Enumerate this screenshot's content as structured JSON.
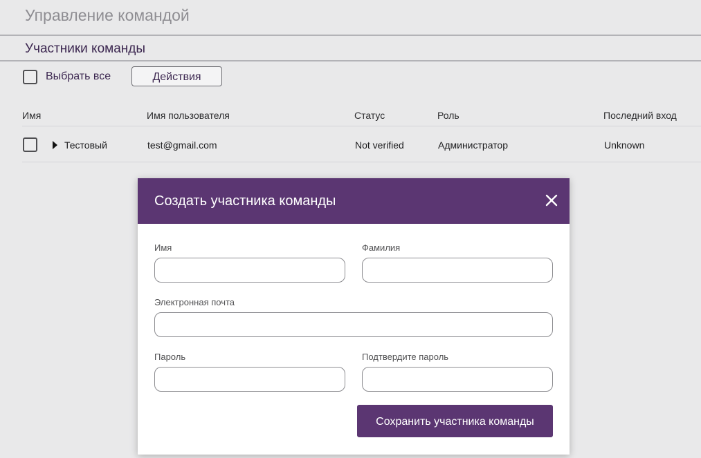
{
  "page": {
    "title": "Управление командой",
    "section_title": "Участники команды"
  },
  "toolbar": {
    "select_all_label": "Выбрать все",
    "actions_label": "Действия"
  },
  "table": {
    "headers": {
      "name": "Имя",
      "username": "Имя пользователя",
      "status": "Статус",
      "role": "Роль",
      "last_login": "Последний вход"
    },
    "rows": [
      {
        "name": "Тестовый",
        "username": "test@gmail.com",
        "status": "Not verified",
        "role": "Администратор",
        "last_login": "Unknown"
      }
    ]
  },
  "modal": {
    "title": "Создать участника команды",
    "fields": {
      "first_name": {
        "label": "Имя",
        "value": ""
      },
      "last_name": {
        "label": "Фамилия",
        "value": ""
      },
      "email": {
        "label": "Электронная почта",
        "value": ""
      },
      "password": {
        "label": "Пароль",
        "value": ""
      },
      "confirm_password": {
        "label": "Подтвердите пароль",
        "value": ""
      }
    },
    "save_label": "Сохранить участника команды",
    "close_icon": "close-icon"
  },
  "colors": {
    "accent": "#5b3672",
    "background": "#e9e9ea",
    "heading_text": "#3c2750"
  }
}
